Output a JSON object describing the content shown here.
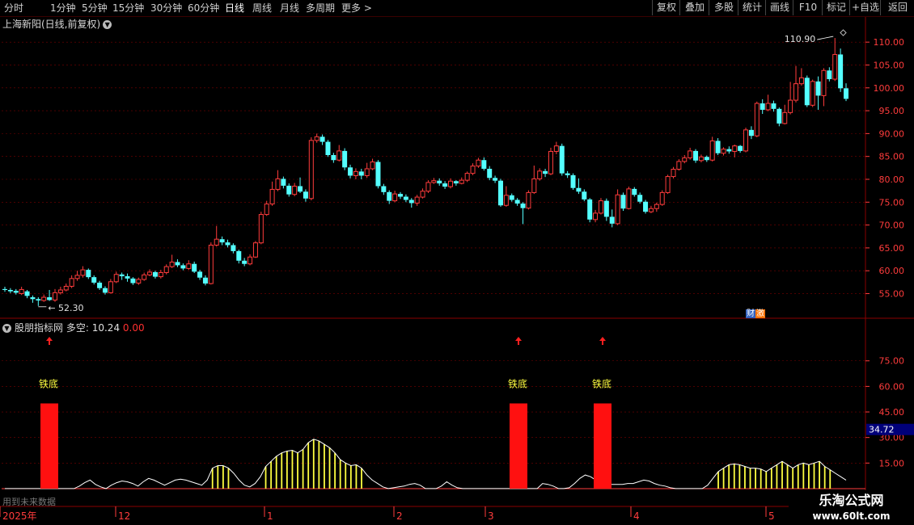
{
  "toolbar": {
    "periods": [
      "分时",
      "1分钟",
      "5分钟",
      "15分钟",
      "30分钟",
      "60分钟",
      "日线",
      "周线",
      "月线",
      "多周期",
      "更多"
    ],
    "active": "日线",
    "right_buttons": [
      "复权",
      "叠加",
      "多股",
      "统计",
      "画线",
      "F10",
      "标记",
      "+自选",
      "返回"
    ]
  },
  "stock": {
    "title": "上海新阳(日线,前复权)",
    "high_label": "110.90",
    "low_label": "52.30",
    "badge": "财",
    "badge2": "激"
  },
  "indicator": {
    "name": "股朋指标网",
    "label": "多空:",
    "value": "10.24",
    "value2": "0.00",
    "signal_text": "铁底",
    "current_readout": "34.72"
  },
  "colors": {
    "up": "#ff3c3c",
    "down": "#54ffff",
    "grid": "#7a0000",
    "axis_text": "#ff3c3c",
    "signal_bar": "#ff1010",
    "yellow_bar": "#ffff40",
    "line": "#ffffff",
    "readout_bg": "#00007a"
  },
  "bottom_axis": {
    "year_label": "2025年",
    "months": [
      "12",
      "1",
      "2",
      "3",
      "4",
      "5"
    ],
    "note": "用到未来数据"
  },
  "watermark": {
    "title": "乐淘公式网",
    "url": "www.60lt.com"
  },
  "chart_data": [
    {
      "type": "candlestick",
      "title": "上海新阳(日线,前复权)",
      "yticks": [
        55,
        60,
        65,
        70,
        75,
        80,
        85,
        90,
        95,
        100,
        105,
        110
      ],
      "ylim": [
        50.5,
        112.5
      ],
      "annotations": [
        {
          "text": "110.90",
          "value": 110.9
        },
        {
          "text": "52.30",
          "value": 52.3
        }
      ],
      "candles": [
        [
          56,
          55.8,
          56.5,
          55.4
        ],
        [
          55.8,
          55.5,
          56.2,
          55.1
        ],
        [
          55.6,
          55.2,
          56,
          54.8
        ],
        [
          55,
          55.9,
          56.5,
          54.7
        ],
        [
          55.5,
          54.5,
          55.8,
          54
        ],
        [
          54.2,
          53.8,
          54.6,
          53
        ],
        [
          53.8,
          53.5,
          54.2,
          52.3
        ],
        [
          53.5,
          54.2,
          54.8,
          53.2
        ],
        [
          54.2,
          53.6,
          55.8,
          53.4
        ],
        [
          53.6,
          55.2,
          56,
          53.2
        ],
        [
          55.2,
          55.8,
          56.5,
          54.8
        ],
        [
          55.8,
          56.6,
          57.2,
          55.5
        ],
        [
          56.6,
          58.3,
          59,
          56.2
        ],
        [
          58.3,
          59,
          60,
          57.8
        ],
        [
          59,
          60.2,
          61,
          58.5
        ],
        [
          60.2,
          58.6,
          60.5,
          58.2
        ],
        [
          58.6,
          57.4,
          59,
          57
        ],
        [
          57.4,
          56.2,
          57.8,
          55.8
        ],
        [
          56.2,
          55.2,
          56.6,
          54.8
        ],
        [
          55.2,
          57.6,
          58.2,
          55
        ],
        [
          57.6,
          59.2,
          59.8,
          57.3
        ],
        [
          59.2,
          58.8,
          59.6,
          58
        ],
        [
          58.8,
          58.3,
          59.4,
          57.6
        ],
        [
          58.3,
          57.3,
          58.6,
          56.9
        ],
        [
          57.3,
          58.1,
          58.5,
          56.9
        ],
        [
          58.1,
          59.1,
          59.6,
          57.8
        ],
        [
          59.1,
          59.7,
          60.3,
          58.8
        ],
        [
          59.7,
          58.7,
          60,
          58.3
        ],
        [
          58.7,
          59.6,
          60.2,
          58.3
        ],
        [
          59.6,
          60.9,
          61.4,
          59.2
        ],
        [
          60.9,
          61.9,
          63.5,
          60.6
        ],
        [
          61.9,
          61.2,
          62.5,
          60.8
        ],
        [
          61.2,
          60.5,
          61.6,
          60.1
        ],
        [
          60.5,
          61.5,
          62.3,
          60.2
        ],
        [
          61.5,
          59.8,
          62,
          59.5
        ],
        [
          59.8,
          58.5,
          60.2,
          58
        ],
        [
          58.5,
          57.2,
          59,
          56.8
        ],
        [
          57.2,
          65.6,
          66.2,
          57
        ],
        [
          65.6,
          66.9,
          69.8,
          65.3
        ],
        [
          66.9,
          66.2,
          67.5,
          65.6
        ],
        [
          66.2,
          65.6,
          66.8,
          65.1
        ],
        [
          65.6,
          64.3,
          66,
          63.8
        ],
        [
          64.3,
          62.2,
          64.6,
          61.6
        ],
        [
          62.2,
          61.5,
          62.8,
          61
        ],
        [
          61.5,
          63,
          63.6,
          61.2
        ],
        [
          63,
          66.1,
          66.5,
          62.8
        ],
        [
          66.1,
          72.3,
          72.9,
          65.8
        ],
        [
          72.3,
          74.6,
          75.3,
          72
        ],
        [
          74.6,
          77.8,
          79.5,
          74.2
        ],
        [
          77.8,
          80.1,
          82,
          77.4
        ],
        [
          80.1,
          78.6,
          80.6,
          78
        ],
        [
          78.6,
          76.7,
          79.1,
          76.2
        ],
        [
          76.7,
          78.5,
          79.2,
          76.3
        ],
        [
          78.5,
          77.3,
          80.4,
          77
        ],
        [
          77.3,
          75.8,
          77.8,
          75.1
        ],
        [
          75.8,
          88.5,
          89.2,
          75.4
        ],
        [
          88.5,
          89.3,
          90,
          88
        ],
        [
          89.3,
          88.2,
          89.8,
          87.5
        ],
        [
          88.2,
          85.3,
          88.6,
          84.9
        ],
        [
          85.3,
          84.2,
          85.8,
          83.6
        ],
        [
          84.2,
          86.2,
          87.5,
          83.9
        ],
        [
          86.2,
          82.6,
          86.8,
          82
        ],
        [
          82.6,
          80.8,
          83.2,
          80.2
        ],
        [
          80.8,
          81.7,
          82.4,
          80
        ],
        [
          81.7,
          80.8,
          82.3,
          80
        ],
        [
          80.8,
          82.3,
          83.6,
          80.3
        ],
        [
          82.3,
          83.8,
          84.5,
          82
        ],
        [
          83.8,
          78.5,
          84.2,
          78
        ],
        [
          78.5,
          77.2,
          79,
          76.6
        ],
        [
          77.2,
          75.3,
          77.6,
          74.6
        ],
        [
          75.3,
          76.8,
          77.5,
          75
        ],
        [
          76.8,
          76.2,
          77.2,
          75.7
        ],
        [
          76.2,
          75.5,
          76.7,
          75
        ],
        [
          75.5,
          74.8,
          75.9,
          73.8
        ],
        [
          74.8,
          76.1,
          76.6,
          74.2
        ],
        [
          76.1,
          77.4,
          78,
          75.8
        ],
        [
          77.4,
          79.3,
          79.8,
          77
        ],
        [
          79.3,
          79.7,
          80.3,
          79
        ],
        [
          79.7,
          79.1,
          80.2,
          78.6
        ],
        [
          79.1,
          78.4,
          79.6,
          77.9
        ],
        [
          78.4,
          79.6,
          80.2,
          78
        ],
        [
          79.6,
          79.1,
          79.8,
          78.6
        ],
        [
          79.1,
          79.8,
          80.4,
          78.9
        ],
        [
          79.8,
          81.3,
          81.7,
          79.4
        ],
        [
          81.3,
          82.9,
          83.5,
          80.9
        ],
        [
          82.9,
          84.2,
          84.7,
          82.5
        ],
        [
          84.2,
          82.3,
          84.8,
          81.9
        ],
        [
          82.3,
          80.3,
          82.9,
          79.8
        ],
        [
          80.3,
          79.7,
          80.8,
          79.2
        ],
        [
          79.7,
          74.3,
          80.1,
          74
        ],
        [
          74.3,
          76.5,
          78.5,
          74
        ],
        [
          76.5,
          75.5,
          76.9,
          75.1
        ],
        [
          75.5,
          74.7,
          75.9,
          74.2
        ],
        [
          74.7,
          73.7,
          75,
          70.2
        ],
        [
          73.7,
          77.1,
          77.6,
          73.4
        ],
        [
          77.1,
          80.1,
          83,
          76.8
        ],
        [
          80.1,
          81.8,
          82.4,
          79.7
        ],
        [
          81.8,
          81.2,
          82.3,
          80.5
        ],
        [
          81.2,
          86.1,
          86.9,
          80.9
        ],
        [
          86.1,
          87.3,
          88.2,
          85.5
        ],
        [
          87.3,
          81.3,
          87.8,
          80.8
        ],
        [
          81.3,
          80.9,
          81.8,
          80.3
        ],
        [
          80.9,
          78.1,
          81.3,
          77.7
        ],
        [
          78.1,
          77.3,
          80.2,
          76.8
        ],
        [
          77.3,
          75.6,
          77.8,
          75.2
        ],
        [
          75.6,
          71.2,
          75.9,
          70.6
        ],
        [
          71.2,
          72.6,
          73.3,
          70.6
        ],
        [
          72.6,
          75.3,
          75.9,
          72.3
        ],
        [
          75.3,
          71.8,
          75.8,
          70.9
        ],
        [
          71.8,
          70.3,
          73.4,
          69.5
        ],
        [
          70.3,
          76.6,
          77.8,
          70
        ],
        [
          76.6,
          73.6,
          77.1,
          73.1
        ],
        [
          73.6,
          77.9,
          78.4,
          73.4
        ],
        [
          77.9,
          76.6,
          78.3,
          76.2
        ],
        [
          76.6,
          75.1,
          77.1,
          74.7
        ],
        [
          75.1,
          72.9,
          75.5,
          72.5
        ],
        [
          72.9,
          73.6,
          74.2,
          72.6
        ],
        [
          73.6,
          74.5,
          74.9,
          72.9
        ],
        [
          74.5,
          77.1,
          77.6,
          74.2
        ],
        [
          77.1,
          80.6,
          81,
          76.8
        ],
        [
          80.6,
          82.2,
          82.7,
          80.2
        ],
        [
          82.2,
          83.9,
          84.4,
          81.9
        ],
        [
          83.9,
          84.7,
          85.3,
          83.5
        ],
        [
          84.7,
          86.2,
          86.9,
          84.3
        ],
        [
          86.2,
          84.1,
          86.6,
          83.6
        ],
        [
          84.1,
          84.9,
          85.4,
          83.7
        ],
        [
          84.9,
          84.2,
          85.2,
          83.8
        ],
        [
          84.2,
          88.4,
          89.3,
          83.9
        ],
        [
          88.4,
          85.7,
          89,
          85.3
        ],
        [
          85.7,
          86.6,
          87,
          85.2
        ],
        [
          86.6,
          86.1,
          87.2,
          85.6
        ],
        [
          86.1,
          87.3,
          87.6,
          84.8
        ],
        [
          87.3,
          86.2,
          87.5,
          85.8
        ],
        [
          86.2,
          90.8,
          91.3,
          85.9
        ],
        [
          90.8,
          89.5,
          91.6,
          88.8
        ],
        [
          89.5,
          96.6,
          97,
          89.2
        ],
        [
          96.6,
          95.2,
          97.5,
          94.3
        ],
        [
          95.2,
          96.6,
          98.5,
          94.9
        ],
        [
          96.6,
          95.4,
          97.2,
          94.8
        ],
        [
          95.4,
          92.2,
          95.7,
          91.6
        ],
        [
          92.2,
          94.6,
          96.3,
          92
        ],
        [
          94.6,
          97.3,
          101.3,
          94.2
        ],
        [
          97.3,
          100.9,
          104.8,
          96.8
        ],
        [
          100.9,
          102.2,
          104.3,
          100.5
        ],
        [
          102.2,
          96.2,
          102.7,
          95.8
        ],
        [
          96.2,
          101.4,
          101.8,
          95.8
        ],
        [
          101.4,
          98.3,
          102.5,
          95.2
        ],
        [
          98.3,
          103.8,
          104.3,
          96
        ],
        [
          103.8,
          101.9,
          104.5,
          101.4
        ],
        [
          101.9,
          107.3,
          110.9,
          101.5
        ],
        [
          107.3,
          99.9,
          108.6,
          99.1
        ],
        [
          99.9,
          97.6,
          101,
          97.1
        ]
      ]
    },
    {
      "type": "bar",
      "title": "股朋指标网 多空",
      "yticks": [
        15,
        30,
        45,
        60,
        75
      ],
      "ylim": [
        -0.5,
        91
      ],
      "series": [
        {
          "name": "多空",
          "values": [
            0,
            0,
            0,
            0,
            0,
            0,
            0,
            0,
            0,
            0,
            0,
            0,
            0,
            0,
            1.5,
            3.5,
            5,
            2.5,
            1,
            0,
            2,
            3.5,
            4.5,
            4,
            3,
            1.5,
            4,
            6,
            5,
            3.5,
            2,
            3.5,
            5,
            5.5,
            5,
            4,
            3,
            2,
            5,
            12,
            13.5,
            13.5,
            12,
            9,
            5,
            2,
            1,
            3,
            7,
            13,
            16,
            19,
            21,
            22,
            22.5,
            21,
            23,
            27,
            29,
            28,
            26,
            24,
            21,
            17,
            15,
            13.5,
            14,
            12,
            8,
            5,
            3,
            1,
            0,
            0.5,
            1,
            1.5,
            2.5,
            3,
            2,
            0,
            0,
            0,
            1.5,
            4,
            2,
            0.5,
            0,
            0,
            0,
            0,
            0,
            0,
            0,
            0,
            0,
            0,
            0,
            0,
            0,
            0,
            0,
            3,
            2.5,
            1.5,
            0,
            0,
            0.5,
            3,
            6,
            8,
            7,
            5,
            4,
            3,
            2.5,
            2.5,
            2.5,
            3,
            3,
            4,
            5,
            4.5,
            3,
            2,
            1.5,
            0.5,
            0,
            0,
            0,
            0,
            0,
            0,
            2,
            6,
            10,
            12,
            14,
            14.5,
            14,
            13,
            12,
            12,
            11.5,
            10,
            12,
            14,
            16,
            14,
            12,
            14,
            15,
            14,
            15,
            16,
            13,
            11,
            9,
            7,
            5
          ]
        }
      ],
      "signals": [
        {
          "text": "铁底",
          "index": 6,
          "value": 50
        },
        {
          "text": "铁底",
          "index": 87,
          "value": 50
        },
        {
          "text": "铁底",
          "index": 102,
          "value": 50
        }
      ],
      "readout": 34.72
    }
  ]
}
